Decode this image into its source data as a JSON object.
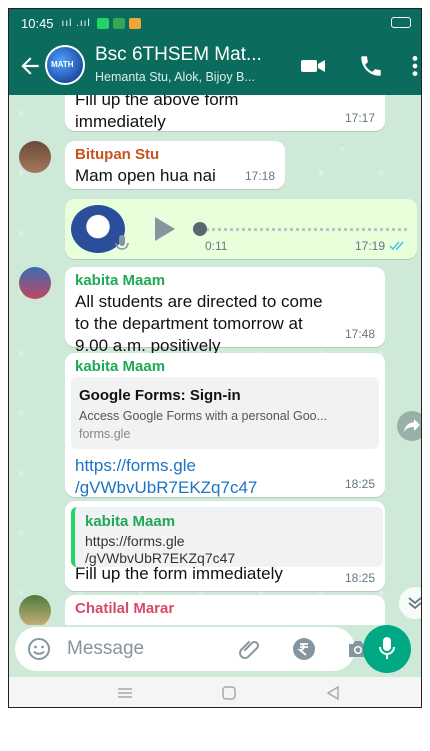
{
  "status_bar": {
    "time": "10:45",
    "signal": "ııl .ııl"
  },
  "header": {
    "group_name": "Bsc 6THSEM Mat...",
    "members": "Hemanta Stu, Alok, Bijoy B...",
    "avatar_text": "MATH"
  },
  "messages": [
    {
      "type": "text",
      "text_lines": [
        "Fill up the above form",
        "immediately"
      ],
      "time": "17:17"
    },
    {
      "type": "text",
      "sender": "Bitupan Stu",
      "sender_color": "#c8541e",
      "text": "Mam open hua nai",
      "time": "17:18"
    },
    {
      "type": "voice",
      "duration": "0:11",
      "time": "17:19",
      "status": "read"
    },
    {
      "type": "text",
      "sender": "kabita Maam",
      "sender_color": "#1fa855",
      "text_lines": [
        "All students are directed to come",
        "to the department tomorrow at",
        "9.00 a.m. positively"
      ],
      "time": "17:48"
    },
    {
      "type": "link",
      "sender": "kabita Maam",
      "preview": {
        "title": "Google Forms: Sign-in",
        "description": "Access Google Forms with a personal Goo...",
        "domain": "forms.gle"
      },
      "link_lines": [
        "https://forms.gle",
        "/gVWbvUbR7EKZq7c47"
      ],
      "time": "18:25"
    },
    {
      "type": "reply",
      "quote": {
        "sender": "kabita Maam",
        "lines": [
          "https://forms.gle",
          "/gVWbvUbR7EKZq7c47"
        ]
      },
      "text": "Fill up the form immediately",
      "time": "18:25"
    },
    {
      "type": "text",
      "sender": "Chatilal Marar",
      "sender_color": "#d64b6a"
    }
  ],
  "input": {
    "placeholder": "Message"
  },
  "colors": {
    "header": "#0b6b5c",
    "accent": "#00a884",
    "outgoing": "#e7ffdb",
    "read_ticks": "#53bdeb"
  }
}
